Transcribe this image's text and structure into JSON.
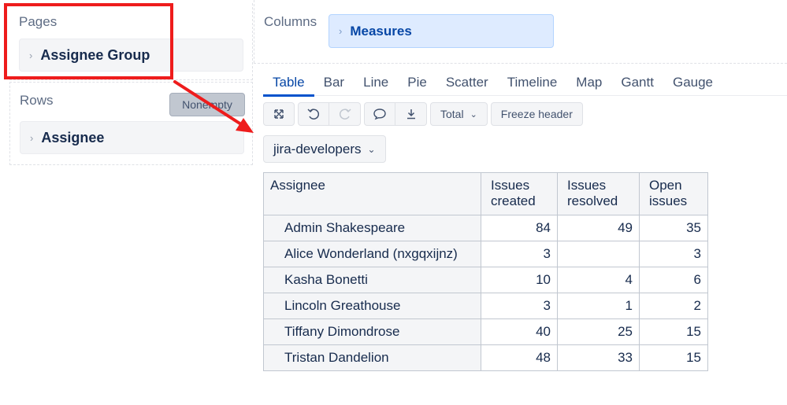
{
  "pages": {
    "label": "Pages",
    "item": "Assignee Group"
  },
  "rows": {
    "label": "Rows",
    "item": "Assignee",
    "nonempty_label": "Nonempty"
  },
  "columns": {
    "label": "Columns",
    "item": "Measures"
  },
  "tabs": [
    "Table",
    "Bar",
    "Line",
    "Pie",
    "Scatter",
    "Timeline",
    "Map",
    "Gantt",
    "Gauge"
  ],
  "active_tab": "Table",
  "toolbar": {
    "icons": [
      "expand-icon",
      "undo-icon",
      "redo-icon",
      "comment-icon",
      "download-icon"
    ],
    "total_label": "Total",
    "freeze_label": "Freeze header"
  },
  "page_selector": {
    "value": "jira-developers"
  },
  "table": {
    "headers": [
      "Assignee",
      "Issues created",
      "Issues resolved",
      "Open issues"
    ],
    "rows": [
      {
        "name": "Admin Shakespeare",
        "created": "84",
        "resolved": "49",
        "open": "35"
      },
      {
        "name": "Alice Wonderland (nxgqxijnz)",
        "created": "3",
        "resolved": "",
        "open": "3"
      },
      {
        "name": "Kasha Bonetti",
        "created": "10",
        "resolved": "4",
        "open": "6"
      },
      {
        "name": "Lincoln Greathouse",
        "created": "3",
        "resolved": "1",
        "open": "2"
      },
      {
        "name": "Tiffany Dimondrose",
        "created": "40",
        "resolved": "25",
        "open": "15"
      },
      {
        "name": "Tristan Dandelion",
        "created": "48",
        "resolved": "33",
        "open": "15"
      }
    ]
  },
  "annotation_color": "#ee1c1c",
  "accent_color": "#0052cc"
}
